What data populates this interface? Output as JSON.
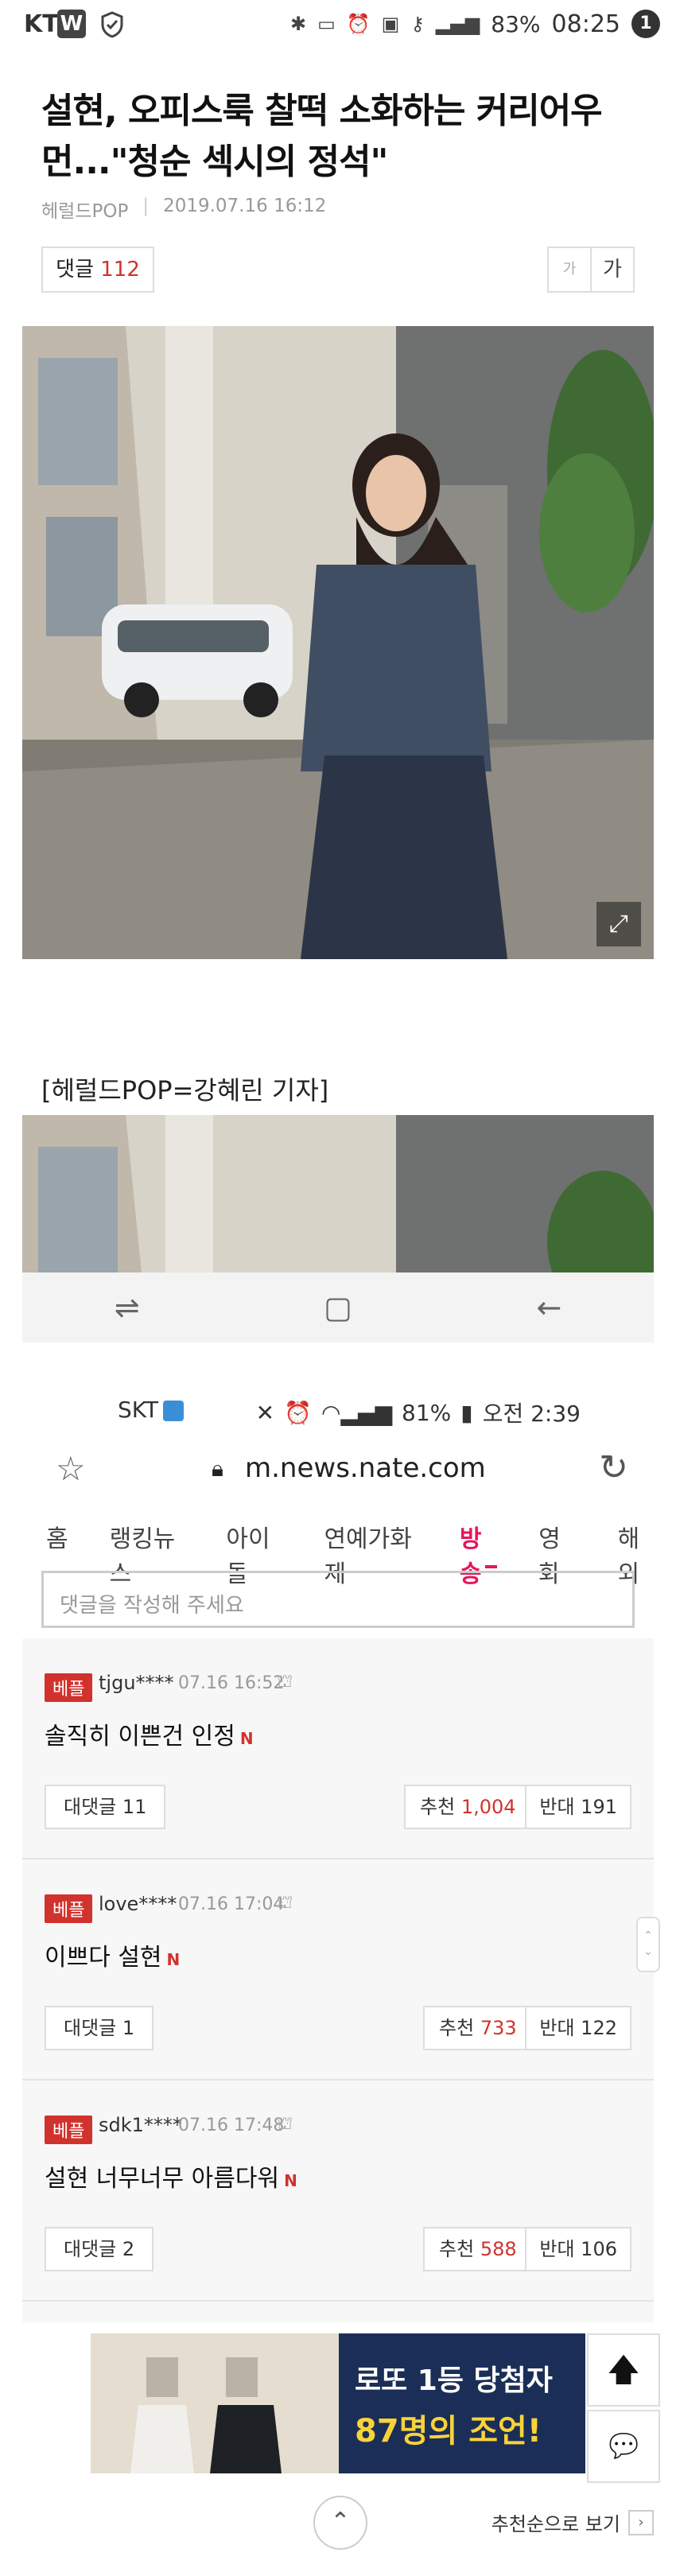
{
  "status_bar_1": {
    "carrier": "KT",
    "app_badge": "W",
    "battery": "83%",
    "time": "08:25",
    "notification_count": "1"
  },
  "article": {
    "title": "설현, 오피스룩 찰떡 소화하는 커리어우먼...\"청순 섹시의 정석\"",
    "source": "헤럴드POP",
    "date": "2019.07.16 16:12",
    "comment_label": "댓글",
    "comment_count": "112",
    "font_small": "가",
    "font_large": "가",
    "byline": "[헤럴드POP=강혜린 기자]"
  },
  "status_bar_2": {
    "carrier": "SKT",
    "battery": "81%",
    "time": "오전 2:39"
  },
  "browser": {
    "url": "m.news.nate.com"
  },
  "category_nav": [
    {
      "label": "홈",
      "active": false
    },
    {
      "label": "랭킹뉴스",
      "active": false
    },
    {
      "label": "아이돌",
      "active": false
    },
    {
      "label": "연예가화제",
      "active": false
    },
    {
      "label": "방송",
      "active": true
    },
    {
      "label": "영화",
      "active": false
    },
    {
      "label": "해외",
      "active": false
    }
  ],
  "comment_input": {
    "placeholder": "댓글을 작성해 주세요"
  },
  "comments": [
    {
      "badge": "베플",
      "user": "tjgu****",
      "date": "07.16 16:52",
      "text": "솔직히 이쁜건 인정",
      "new_badge": "N",
      "reply_label": "대댓글 11",
      "recommend_label": "추천",
      "recommend_count": "1,004",
      "oppose_label": "반대 191"
    },
    {
      "badge": "베플",
      "user": "love****",
      "date": "07.16 17:04",
      "text": "이쁘다 설현",
      "new_badge": "N",
      "reply_label": "대댓글 1",
      "recommend_label": "추천",
      "recommend_count": "733",
      "oppose_label": "반대 122"
    },
    {
      "badge": "베플",
      "user": "sdk1****",
      "date": "07.16 17:48",
      "text": "설현 너무너무 아름다워",
      "new_badge": "N",
      "reply_label": "대댓글 2",
      "recommend_label": "추천",
      "recommend_count": "588",
      "oppose_label": "반대 106"
    }
  ],
  "ad": {
    "line1": "로또 1등 당첨자",
    "line2": "87명의 조언!"
  },
  "footer": {
    "sort_label": "추천순으로 보기"
  }
}
